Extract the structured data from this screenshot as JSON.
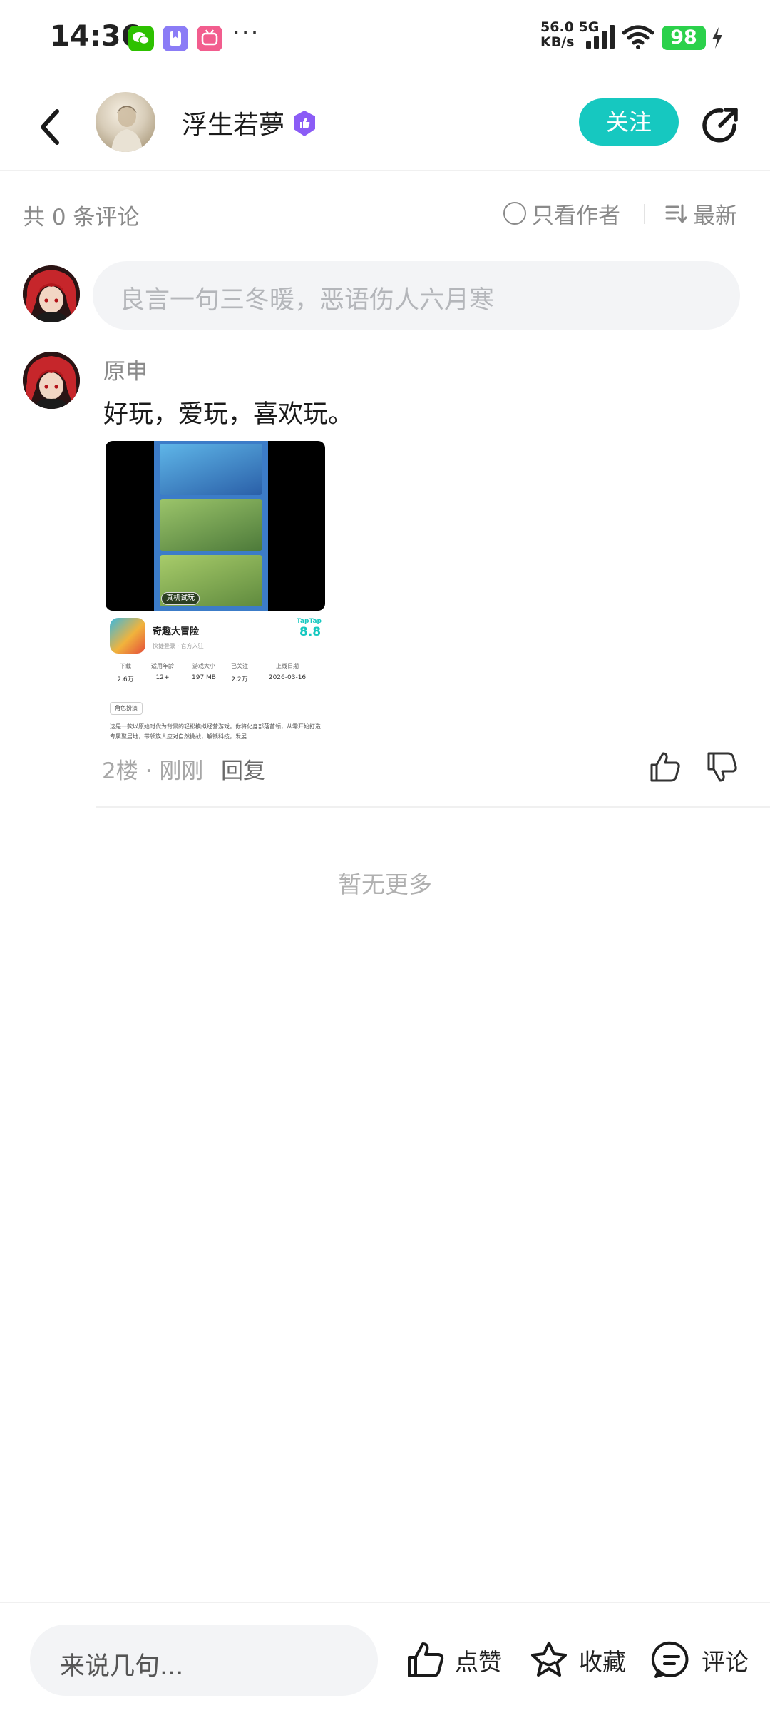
{
  "status_bar": {
    "time": "14:36",
    "more": "···",
    "net_speed_value": "56.0",
    "net_speed_unit": "KB/s",
    "network_type": "5G",
    "battery": "98",
    "app_icons": [
      "wechat-icon",
      "bookmark-app-icon",
      "bilibili-icon"
    ]
  },
  "header": {
    "author_name": "浮生若夢",
    "follow_label": "关注"
  },
  "comments_bar": {
    "count_text": "共 0 条评论",
    "only_author_label": "只看作者",
    "sort_label": "最新"
  },
  "comment_input": {
    "placeholder": "良言一句三冬暖，恶语伤人六月寒"
  },
  "comment": {
    "user_name": "原申",
    "text": "好玩，爱玩，喜欢玩。",
    "floor": "2楼",
    "dot": "·",
    "time": "刚刚",
    "reply_label": "回复",
    "image": {
      "trial_button": "真机试玩",
      "app_name": "奇趣大冒险",
      "app_sub": "快捷登录 · 官方入驻",
      "brand": "TapTap",
      "score": "8.8",
      "stats": [
        {
          "label": "下载",
          "value": "2.6万"
        },
        {
          "label": "适用年龄",
          "value": "12+"
        },
        {
          "label": "游戏大小",
          "value": "197 MB"
        },
        {
          "label": "已关注",
          "value": "2.2万"
        },
        {
          "label": "上线日期",
          "value": "2026-03-16"
        }
      ],
      "tag": "角色扮演",
      "description": "这是一款以原始时代为背景的轻松模拟经营游戏。你将化身部落首领，从零开始打造专属聚居地，带领族人应对自然挑战，解锁科技，发展..."
    }
  },
  "list_end_text": "暂无更多",
  "bottom_bar": {
    "input_placeholder": "来说几句...",
    "like_label": "点赞",
    "favorite_label": "收藏",
    "comment_label": "评论"
  },
  "colors": {
    "accent": "#16c8c0",
    "verified": "#8b5cf6",
    "battery": "#2bd14b"
  }
}
